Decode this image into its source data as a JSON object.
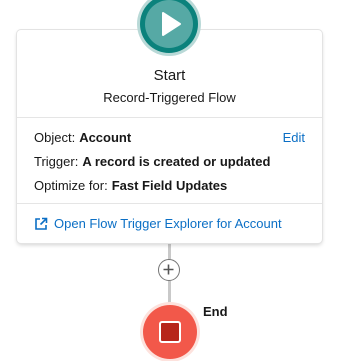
{
  "start_node": {
    "icon": "play-icon",
    "title": "Start",
    "subtitle": "Record-Triggered Flow",
    "edit_label": "Edit",
    "details": [
      {
        "label": "Object:",
        "value": "Account"
      },
      {
        "label": "Trigger:",
        "value": "A record is created or updated"
      },
      {
        "label": "Optimize for:",
        "value": "Fast Field Updates"
      }
    ],
    "explorer_link": "Open Flow Trigger Explorer for Account"
  },
  "add_element": {
    "icon": "plus-circle-icon"
  },
  "end_node": {
    "icon": "stop-icon",
    "label": "End"
  },
  "colors": {
    "start_accent": "#0b827c",
    "end_accent": "#f2584a",
    "link": "#0b6fc5"
  }
}
